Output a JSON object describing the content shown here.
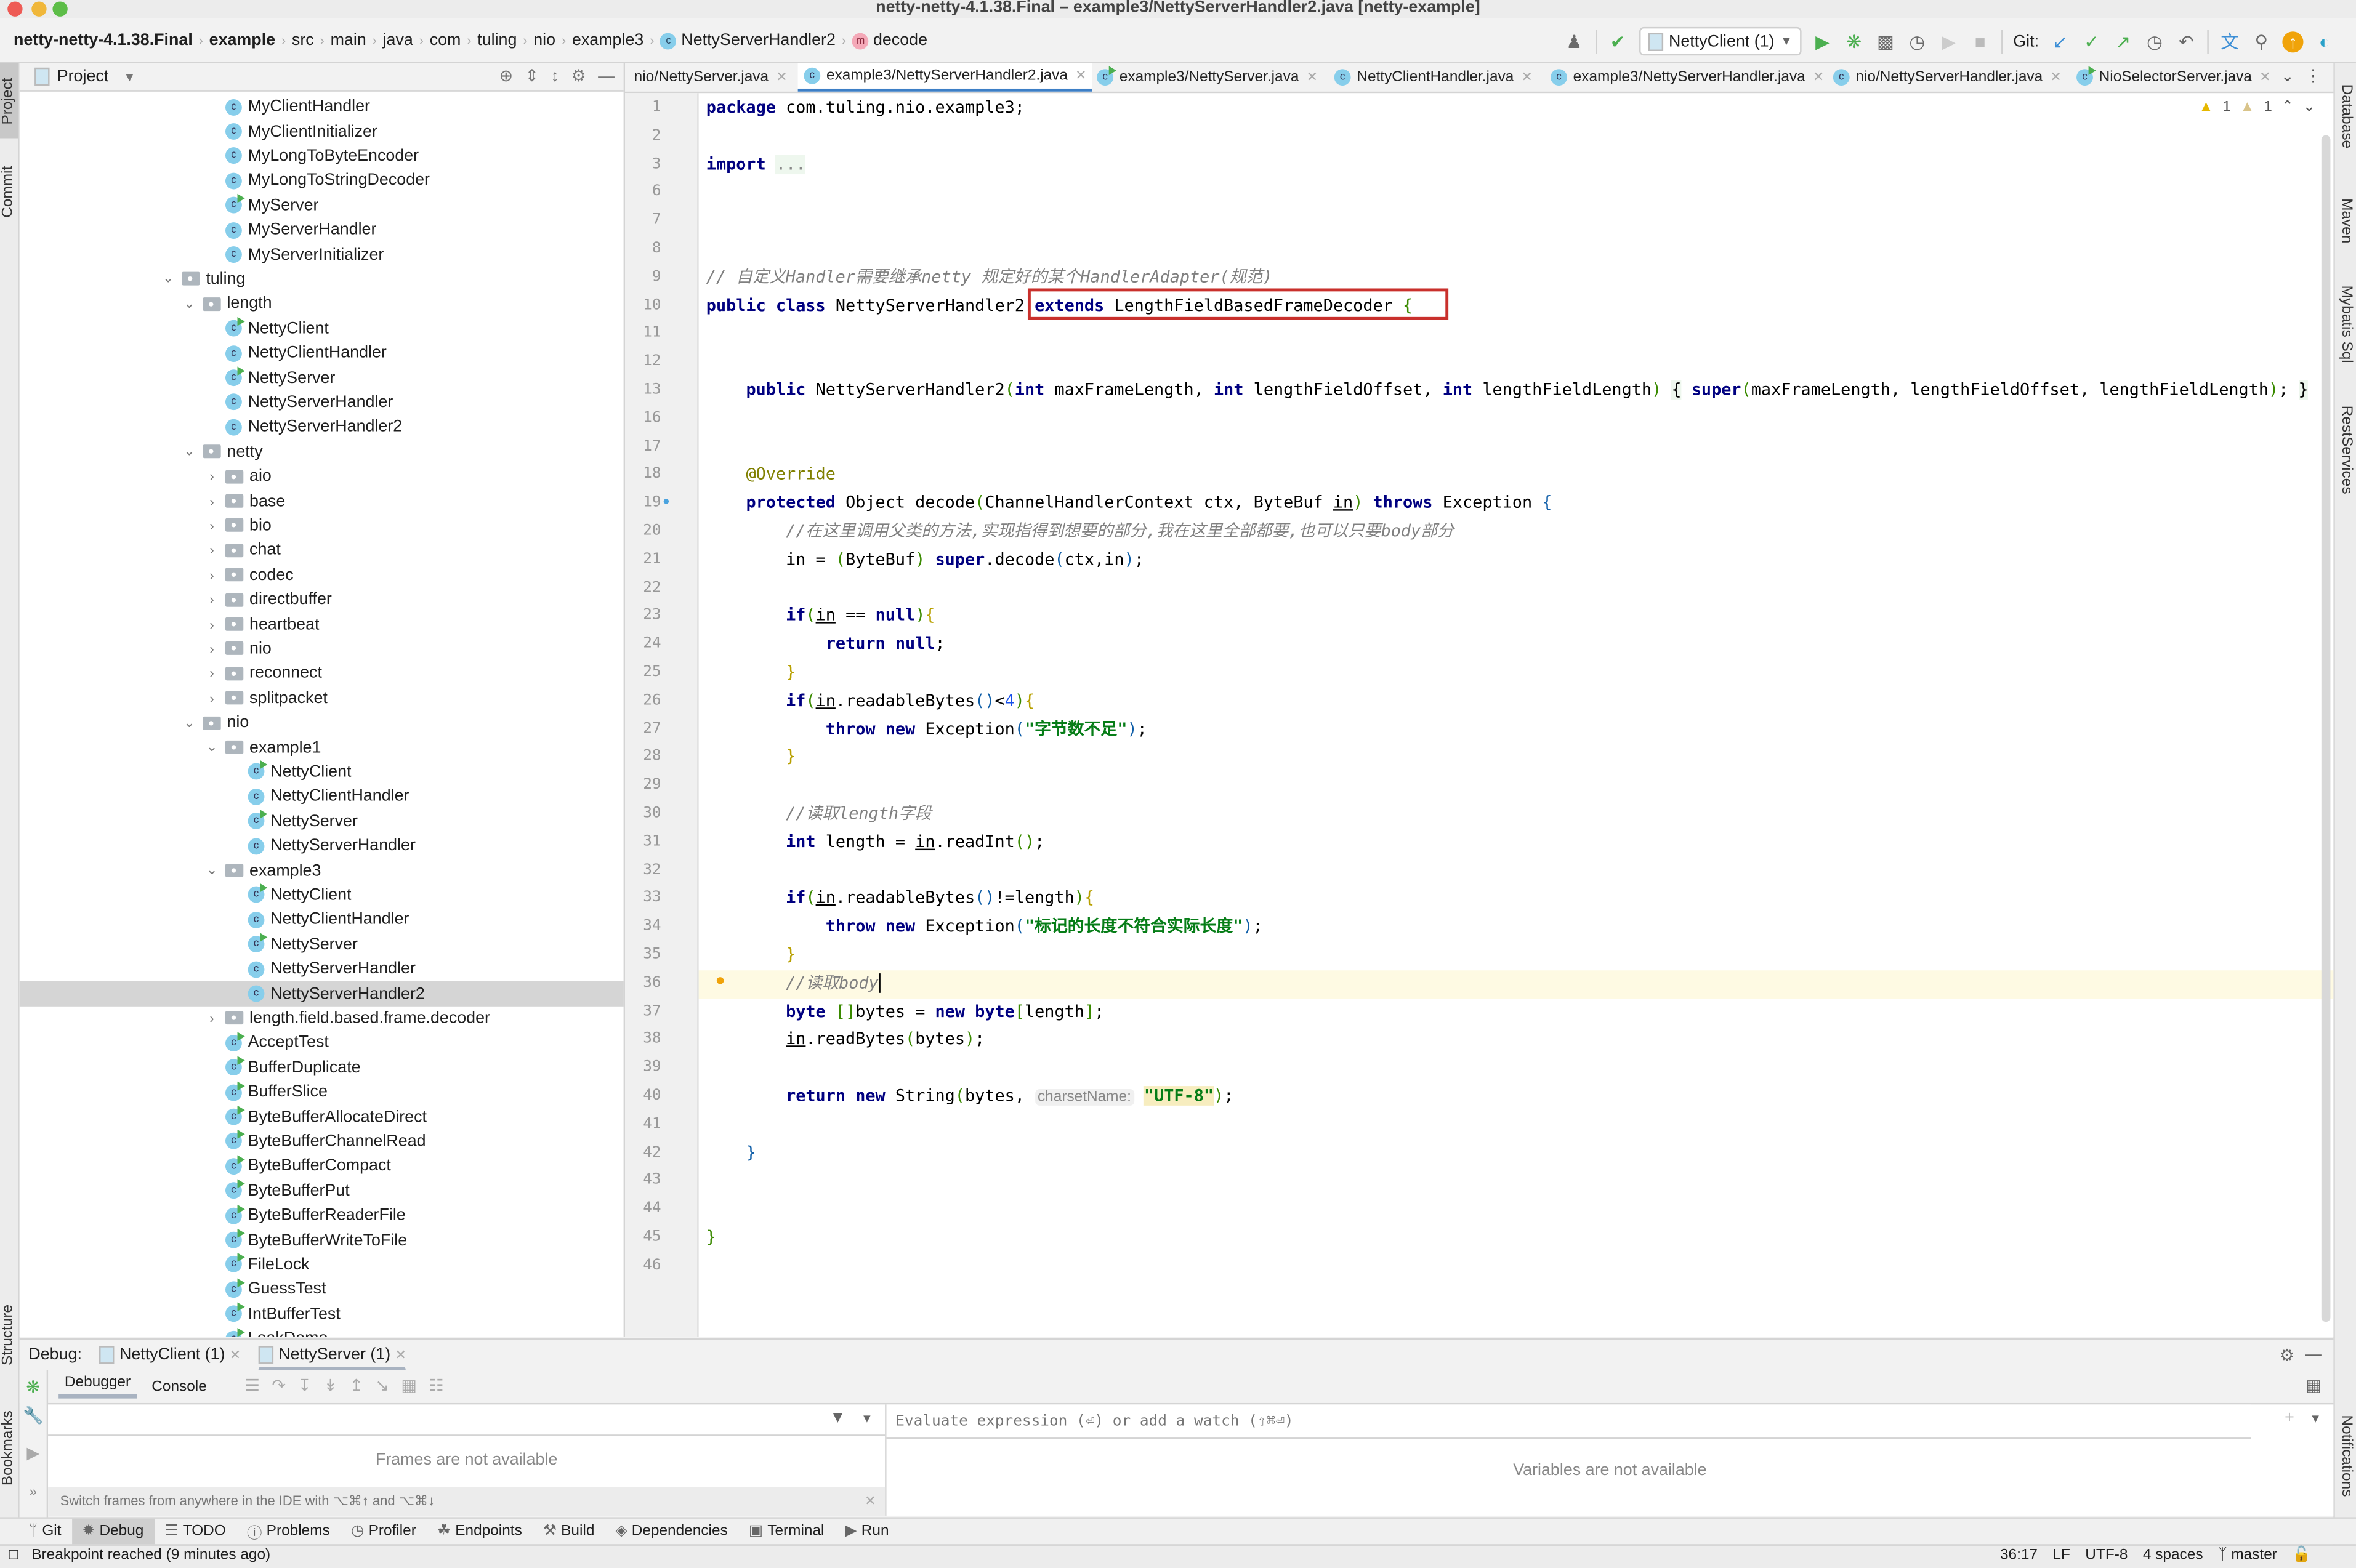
{
  "window": {
    "title": "netty-netty-4.1.38.Final – example3/NettyServerHandler2.java [netty-example]"
  },
  "breadcrumbs": [
    {
      "label": "netty-netty-4.1.38.Final",
      "bold": true
    },
    {
      "label": "example",
      "bold": true
    },
    {
      "label": "src"
    },
    {
      "label": "main"
    },
    {
      "label": "java"
    },
    {
      "label": "com"
    },
    {
      "label": "tuling"
    },
    {
      "label": "nio"
    },
    {
      "label": "example3"
    },
    {
      "label": "NettyServerHandler2",
      "icon": "class-icon"
    },
    {
      "label": "decode",
      "icon": "method-icon"
    }
  ],
  "toolbar": {
    "run_config": "NettyClient (1)",
    "git_label": "Git:"
  },
  "left_strip": {
    "project": "Project",
    "commit": "Commit",
    "structure": "Structure",
    "bookmarks": "Bookmarks"
  },
  "right_strip": {
    "database": "Database",
    "maven": "Maven",
    "mybatis": "Mybatis Sql",
    "rest": "RestServices",
    "notifications": "Notifications"
  },
  "project_panel": {
    "title": "Project",
    "tree": [
      {
        "label": "MyClientHandler",
        "type": "class",
        "depth": 3
      },
      {
        "label": "MyClientInitializer",
        "type": "class",
        "depth": 3
      },
      {
        "label": "MyLongToByteEncoder",
        "type": "class",
        "depth": 3
      },
      {
        "label": "MyLongToStringDecoder",
        "type": "class",
        "depth": 3
      },
      {
        "label": "MyServer",
        "type": "runclass",
        "depth": 3
      },
      {
        "label": "MyServerHandler",
        "type": "class",
        "depth": 3
      },
      {
        "label": "MyServerInitializer",
        "type": "class",
        "depth": 3
      },
      {
        "label": "tuling",
        "type": "folder",
        "depth": 1,
        "expanded": true
      },
      {
        "label": "length",
        "type": "folder",
        "depth": 2,
        "expanded": true
      },
      {
        "label": "NettyClient",
        "type": "runclass",
        "depth": 3
      },
      {
        "label": "NettyClientHandler",
        "type": "class",
        "depth": 3
      },
      {
        "label": "NettyServer",
        "type": "runclass",
        "depth": 3
      },
      {
        "label": "NettyServerHandler",
        "type": "class",
        "depth": 3
      },
      {
        "label": "NettyServerHandler2",
        "type": "class",
        "depth": 3
      },
      {
        "label": "netty",
        "type": "folder",
        "depth": 2,
        "expanded": true
      },
      {
        "label": "aio",
        "type": "folder",
        "depth": 3,
        "expanded": false
      },
      {
        "label": "base",
        "type": "folder",
        "depth": 3,
        "expanded": false
      },
      {
        "label": "bio",
        "type": "folder",
        "depth": 3,
        "expanded": false
      },
      {
        "label": "chat",
        "type": "folder",
        "depth": 3,
        "expanded": false
      },
      {
        "label": "codec",
        "type": "folder",
        "depth": 3,
        "expanded": false
      },
      {
        "label": "directbuffer",
        "type": "folder",
        "depth": 3,
        "expanded": false
      },
      {
        "label": "heartbeat",
        "type": "folder",
        "depth": 3,
        "expanded": false
      },
      {
        "label": "nio",
        "type": "folder",
        "depth": 3,
        "expanded": false
      },
      {
        "label": "reconnect",
        "type": "folder",
        "depth": 3,
        "expanded": false
      },
      {
        "label": "splitpacket",
        "type": "folder",
        "depth": 3,
        "expanded": false
      },
      {
        "label": "nio",
        "type": "folder",
        "depth": 2,
        "expanded": true
      },
      {
        "label": "example1",
        "type": "folder",
        "depth": 3,
        "expanded": true
      },
      {
        "label": "NettyClient",
        "type": "runclass",
        "depth": 4
      },
      {
        "label": "NettyClientHandler",
        "type": "class",
        "depth": 4
      },
      {
        "label": "NettyServer",
        "type": "runclass",
        "depth": 4
      },
      {
        "label": "NettyServerHandler",
        "type": "class",
        "depth": 4
      },
      {
        "label": "example3",
        "type": "folder",
        "depth": 3,
        "expanded": true
      },
      {
        "label": "NettyClient",
        "type": "runclass",
        "depth": 4
      },
      {
        "label": "NettyClientHandler",
        "type": "class",
        "depth": 4
      },
      {
        "label": "NettyServer",
        "type": "runclass",
        "depth": 4
      },
      {
        "label": "NettyServerHandler",
        "type": "class",
        "depth": 4
      },
      {
        "label": "NettyServerHandler2",
        "type": "class",
        "depth": 4,
        "selected": true
      },
      {
        "label": "length.field.based.frame.decoder",
        "type": "folder",
        "depth": 3,
        "expanded": false
      },
      {
        "label": "AcceptTest",
        "type": "runclass",
        "depth": 3
      },
      {
        "label": "BufferDuplicate",
        "type": "runclass",
        "depth": 3
      },
      {
        "label": "BufferSlice",
        "type": "runclass",
        "depth": 3
      },
      {
        "label": "ByteBufferAllocateDirect",
        "type": "runclass",
        "depth": 3
      },
      {
        "label": "ByteBufferChannelRead",
        "type": "runclass",
        "depth": 3
      },
      {
        "label": "ByteBufferCompact",
        "type": "runclass",
        "depth": 3
      },
      {
        "label": "ByteBufferPut",
        "type": "runclass",
        "depth": 3
      },
      {
        "label": "ByteBufferReaderFile",
        "type": "runclass",
        "depth": 3
      },
      {
        "label": "ByteBufferWriteToFile",
        "type": "runclass",
        "depth": 3
      },
      {
        "label": "FileLock",
        "type": "runclass",
        "depth": 3
      },
      {
        "label": "GuessTest",
        "type": "runclass",
        "depth": 3
      },
      {
        "label": "IntBufferTest",
        "type": "runclass",
        "depth": 3
      },
      {
        "label": "LeakDemo",
        "type": "runclass",
        "depth": 3
      }
    ]
  },
  "editor": {
    "tabs": [
      {
        "label": "nio/NettyServer.java",
        "icon": "none"
      },
      {
        "label": "example3/NettyServerHandler2.java",
        "icon": "class",
        "active": true
      },
      {
        "label": "example3/NettyServer.java",
        "icon": "runclass"
      },
      {
        "label": "NettyClientHandler.java",
        "icon": "class"
      },
      {
        "label": "example3/NettyServerHandler.java",
        "icon": "class"
      },
      {
        "label": "nio/NettyServerHandler.java",
        "icon": "class"
      },
      {
        "label": "NioSelectorServer.java",
        "icon": "runclass"
      }
    ],
    "warnings": "1",
    "weak_warnings": "1",
    "caret_line": 36,
    "lines": [
      {
        "n": "1",
        "html": "<span class='kw'>package</span> com.tuling.nio.example3;"
      },
      {
        "n": "2",
        "html": ""
      },
      {
        "n": "3",
        "html": "<span class='kw'>import</span> <span style='color:#888;background:#eef7ee'>...</span>"
      },
      {
        "n": "6",
        "html": ""
      },
      {
        "n": "7",
        "html": ""
      },
      {
        "n": "8",
        "html": ""
      },
      {
        "n": "9",
        "html": "<span class='cm'>// 自定义Handler需要继承netty 规定好的某个HandlerAdapter(规范)</span>"
      },
      {
        "n": "10",
        "html": "<span class='kw'>public class</span> NettyServerHandler2 <span class='kw'>extends</span> LengthFieldBasedFrameDecoder <span class='br1'>{</span>"
      },
      {
        "n": "11",
        "html": ""
      },
      {
        "n": "12",
        "html": ""
      },
      {
        "n": "13",
        "html": "    <span class='kw'>public</span> NettyServerHandler2<span class='br1'>(</span><span class='kw'>int</span> maxFrameLength, <span class='kw'>int</span> lengthFieldOffset, <span class='kw'>int</span> lengthFieldLength<span class='br1'>)</span> <span style='background:#eef7ee'>{</span> <span class='kw'>super</span><span class='br1'>(</span>maxFrameLength, lengthFieldOffset, lengthFieldLength<span class='br1'>)</span>; <span style='background:#eef7ee'>}</span>"
      },
      {
        "n": "16",
        "html": ""
      },
      {
        "n": "17",
        "html": ""
      },
      {
        "n": "18",
        "html": "    <span class='ann'>@Override</span>"
      },
      {
        "n": "19",
        "html": "    <span class='kw'>protected</span> Object decode<span class='br1'>(</span>ChannelHandlerContext ctx, ByteBuf <span class='ul'>in</span><span class='br1'>)</span> <span class='kw'>throws</span> Exception <span class='br3'>{</span>"
      },
      {
        "n": "20",
        "html": "        <span class='cm'>//在这里调用父类的方法,实现指得到想要的部分,我在这里全部都要,也可以只要body部分</span>"
      },
      {
        "n": "21",
        "html": "        in = <span class='br1'>(</span>ByteBuf<span class='br1'>)</span> <span class='kw'>super</span>.decode<span class='br3'>(</span>ctx,in<span class='br3'>)</span>;"
      },
      {
        "n": "22",
        "html": ""
      },
      {
        "n": "23",
        "html": "        <span class='kw'>if</span><span class='br1'>(</span><span class='ul'>in</span> == <span class='kw'>null</span><span class='br1'>)</span><span class='br2'>{</span>"
      },
      {
        "n": "24",
        "html": "            <span class='kw'>return null</span>;"
      },
      {
        "n": "25",
        "html": "        <span class='br2'>}</span>"
      },
      {
        "n": "26",
        "html": "        <span class='kw'>if</span><span class='br1'>(</span><span class='ul'>in</span>.readableBytes<span class='br3'>()</span>&lt;<span class='num'>4</span><span class='br1'>)</span><span class='br2'>{</span>"
      },
      {
        "n": "27",
        "html": "            <span class='kw'>throw new</span> Exception<span class='br3'>(</span><span class='str'>\"字节数不足\"</span><span class='br3'>)</span>;"
      },
      {
        "n": "28",
        "html": "        <span class='br2'>}</span>"
      },
      {
        "n": "29",
        "html": ""
      },
      {
        "n": "30",
        "html": "        <span class='cm'>//读取length字段</span>"
      },
      {
        "n": "31",
        "html": "        <span class='kw'>int</span> length = <span class='ul'>in</span>.readInt<span class='br1'>()</span>;"
      },
      {
        "n": "32",
        "html": ""
      },
      {
        "n": "33",
        "html": "        <span class='kw'>if</span><span class='br1'>(</span><span class='ul'>in</span>.readableBytes<span class='br3'>()</span>!=length<span class='br1'>)</span><span class='br2'>{</span>"
      },
      {
        "n": "34",
        "html": "            <span class='kw'>throw new</span> Exception<span class='br3'>(</span><span class='str'>\"标记的长度不符合实际长度\"</span><span class='br3'>)</span>;"
      },
      {
        "n": "35",
        "html": "        <span class='br2'>}</span>"
      },
      {
        "n": "36",
        "html": "        <span class='cm'>//读取body</span><span style='border-left:1px solid #000'></span>"
      },
      {
        "n": "37",
        "html": "        <span class='kw'>byte</span> <span class='br1'>[]</span>bytes = <span class='kw'>new byte</span><span class='br1'>[</span>length<span class='br1'>]</span>;"
      },
      {
        "n": "38",
        "html": "        <span class='ul'>in</span>.readBytes<span class='br1'>(</span>bytes<span class='br1'>)</span>;"
      },
      {
        "n": "39",
        "html": ""
      },
      {
        "n": "40",
        "html": "        <span class='kw'>return new</span> String<span class='br1'>(</span>bytes, <span class='hint'>charsetName:</span> <span class='str' style='background:#f7edbf'>\"UTF-8\"</span><span class='br1'>)</span>;"
      },
      {
        "n": "41",
        "html": ""
      },
      {
        "n": "42",
        "html": "    <span class='br3'>}</span>"
      },
      {
        "n": "43",
        "html": ""
      },
      {
        "n": "44",
        "html": ""
      },
      {
        "n": "45",
        "html": "<span class='br1'>}</span>"
      },
      {
        "n": "46",
        "html": ""
      }
    ]
  },
  "debug": {
    "label": "Debug:",
    "sessions": [
      {
        "label": "NettyClient (1)"
      },
      {
        "label": "NettyServer (1)",
        "active": true
      }
    ],
    "subtabs": [
      {
        "label": "Debugger",
        "active": true
      },
      {
        "label": "Console"
      }
    ],
    "frames_empty": "Frames are not available",
    "frames_hint": "Switch frames from anywhere in the IDE with ⌥⌘↑ and ⌥⌘↓",
    "watch_placeholder": "Evaluate expression (⏎) or add a watch (⇧⌘⏎)",
    "variables_empty": "Variables are not available"
  },
  "bottom_tabs": [
    {
      "label": "Git",
      "icon": "git-branch-icon"
    },
    {
      "label": "Debug",
      "icon": "bug-icon",
      "active": true
    },
    {
      "label": "TODO",
      "icon": "list-icon"
    },
    {
      "label": "Problems",
      "icon": "problems-icon"
    },
    {
      "label": "Profiler",
      "icon": "profiler-icon"
    },
    {
      "label": "Endpoints",
      "icon": "endpoints-icon"
    },
    {
      "label": "Build",
      "icon": "hammer-icon"
    },
    {
      "label": "Dependencies",
      "icon": "dependencies-icon"
    },
    {
      "label": "Terminal",
      "icon": "terminal-icon"
    },
    {
      "label": "Run",
      "icon": "run-icon"
    }
  ],
  "statusbar": {
    "message": "Breakpoint reached (9 minutes ago)",
    "position": "36:17",
    "line_sep": "LF",
    "encoding": "UTF-8",
    "indent": "4 spaces",
    "branch": "master"
  }
}
